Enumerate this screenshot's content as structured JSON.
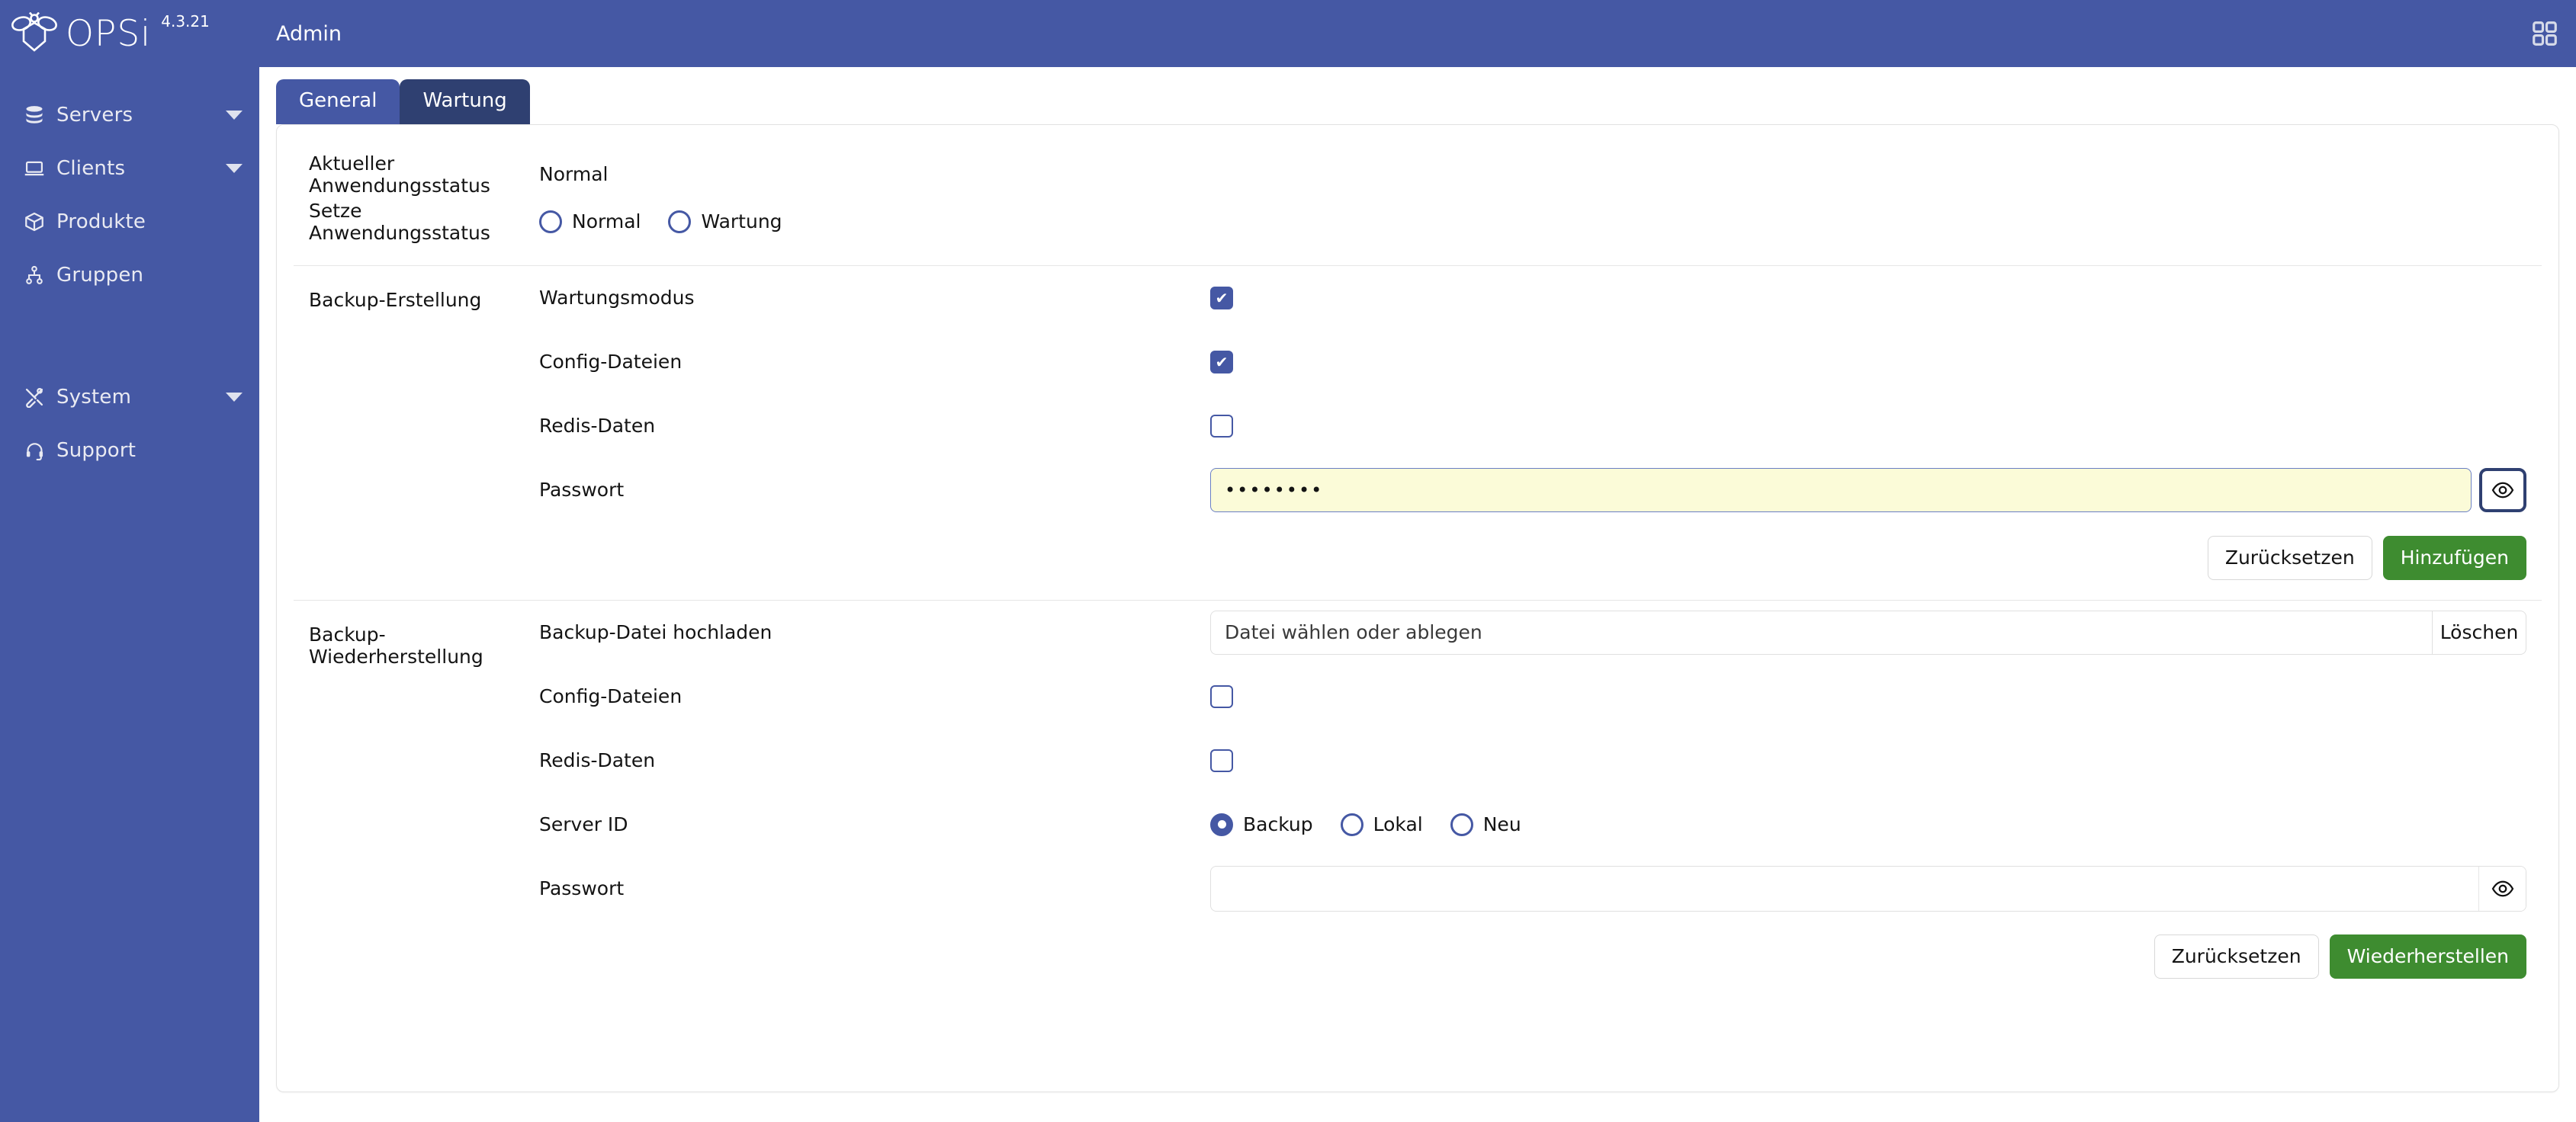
{
  "brand": {
    "name": "OPSi",
    "version": "4.3.21",
    "logo_icon": "bee-icon"
  },
  "topbar": {
    "title": "Admin",
    "apps_icon": "grid-apps-icon"
  },
  "sidebar": {
    "items": [
      {
        "label": "Servers",
        "icon": "database-icon",
        "has_chevron": true
      },
      {
        "label": "Clients",
        "icon": "laptop-icon",
        "has_chevron": true
      },
      {
        "label": "Produkte",
        "icon": "box-icon",
        "has_chevron": false
      },
      {
        "label": "Gruppen",
        "icon": "sitemap-icon",
        "has_chevron": false
      },
      {
        "label": "System",
        "icon": "tools-icon",
        "has_chevron": true
      },
      {
        "label": "Support",
        "icon": "headset-icon",
        "has_chevron": false
      }
    ]
  },
  "tabs": [
    {
      "label": "General",
      "active": false
    },
    {
      "label": "Wartung",
      "active": true
    }
  ],
  "status": {
    "current_label": "Aktueller Anwendungsstatus",
    "current_value": "Normal",
    "set_label": "Setze Anwendungsstatus",
    "options": [
      {
        "label": "Normal",
        "selected": false
      },
      {
        "label": "Wartung",
        "selected": false
      }
    ]
  },
  "backup_create": {
    "section_title": "Backup-Erstellung",
    "fields": [
      {
        "label": "Wartungsmodus",
        "checked": true
      },
      {
        "label": "Config-Dateien",
        "checked": true
      },
      {
        "label": "Redis-Daten",
        "checked": false
      }
    ],
    "password": {
      "label": "Passwort",
      "value": "••••••••",
      "placeholder": "",
      "reveal_icon": "eye-icon",
      "focused": true,
      "autofilled": true
    },
    "buttons": {
      "reset": "Zurücksetzen",
      "submit": "Hinzufügen"
    }
  },
  "backup_restore": {
    "section_title": "Backup-Wiederherstellung",
    "upload": {
      "label": "Backup-Datei hochladen",
      "placeholder": "Datei wählen oder ablegen",
      "delete_label": "Löschen"
    },
    "fields": [
      {
        "label": "Config-Dateien",
        "checked": false
      },
      {
        "label": "Redis-Daten",
        "checked": false
      }
    ],
    "server_id": {
      "label": "Server ID",
      "options": [
        {
          "label": "Backup",
          "selected": true
        },
        {
          "label": "Lokal",
          "selected": false
        },
        {
          "label": "Neu",
          "selected": false
        }
      ]
    },
    "password": {
      "label": "Passwort",
      "value": "",
      "placeholder": "",
      "reveal_icon": "eye-icon",
      "focused": false,
      "autofilled": false
    },
    "buttons": {
      "reset": "Zurücksetzen",
      "submit": "Wiederherstellen"
    }
  },
  "colors": {
    "brand_blue": "#4558a4",
    "tab_active": "#2f4071",
    "accent_green": "#3e8c30",
    "autofill_yellow": "#fbfbd8"
  }
}
